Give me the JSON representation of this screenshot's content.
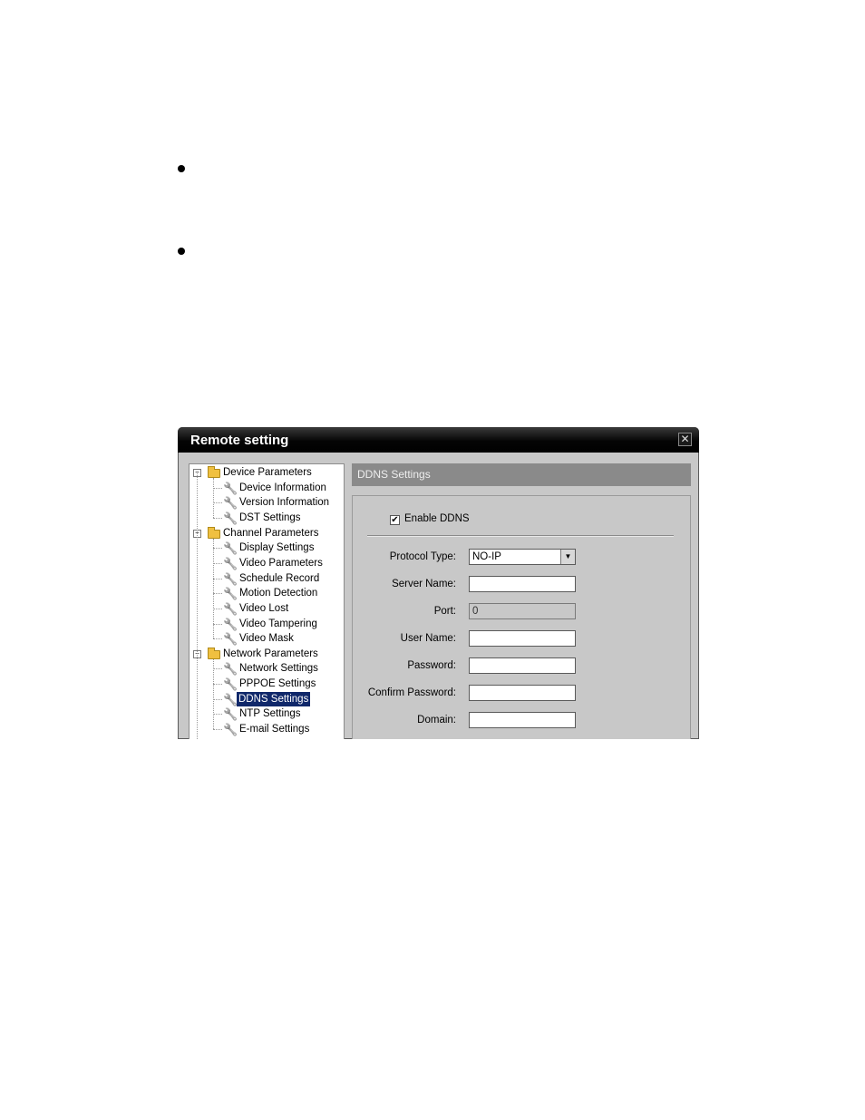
{
  "window": {
    "title": "Remote setting"
  },
  "tree": [
    {
      "label": "Device Parameters",
      "type": "folder"
    },
    {
      "label": "Device Information",
      "type": "item"
    },
    {
      "label": "Version Information",
      "type": "item"
    },
    {
      "label": "DST Settings",
      "type": "item"
    },
    {
      "label": "Channel Parameters",
      "type": "folder"
    },
    {
      "label": "Display Settings",
      "type": "item"
    },
    {
      "label": "Video Parameters",
      "type": "item"
    },
    {
      "label": "Schedule Record",
      "type": "item"
    },
    {
      "label": "Motion Detection",
      "type": "item"
    },
    {
      "label": "Video Lost",
      "type": "item"
    },
    {
      "label": "Video Tampering",
      "type": "item"
    },
    {
      "label": "Video Mask",
      "type": "item"
    },
    {
      "label": "Network Parameters",
      "type": "folder"
    },
    {
      "label": "Network Settings",
      "type": "item"
    },
    {
      "label": "PPPOE Settings",
      "type": "item"
    },
    {
      "label": "DDNS Settings",
      "type": "item",
      "selected": true
    },
    {
      "label": "NTP Settings",
      "type": "item"
    },
    {
      "label": "E-mail Settings",
      "type": "item"
    }
  ],
  "panel": {
    "header": "DDNS Settings",
    "enable_label": "Enable DDNS",
    "enable_checked": true,
    "fields": [
      {
        "label": "Protocol Type:",
        "value": "NO-IP",
        "kind": "select"
      },
      {
        "label": "Server Name:",
        "value": "",
        "kind": "text"
      },
      {
        "label": "Port:",
        "value": "0",
        "kind": "disabled"
      },
      {
        "label": "User Name:",
        "value": "",
        "kind": "text"
      },
      {
        "label": "Password:",
        "value": "",
        "kind": "text"
      },
      {
        "label": "Confirm Password:",
        "value": "",
        "kind": "text"
      },
      {
        "label": "Domain:",
        "value": "",
        "kind": "text"
      }
    ]
  },
  "icons": {
    "close": "close-icon",
    "folder": "folder-icon",
    "item": "wrench-icon",
    "expander": "minus-icon"
  }
}
